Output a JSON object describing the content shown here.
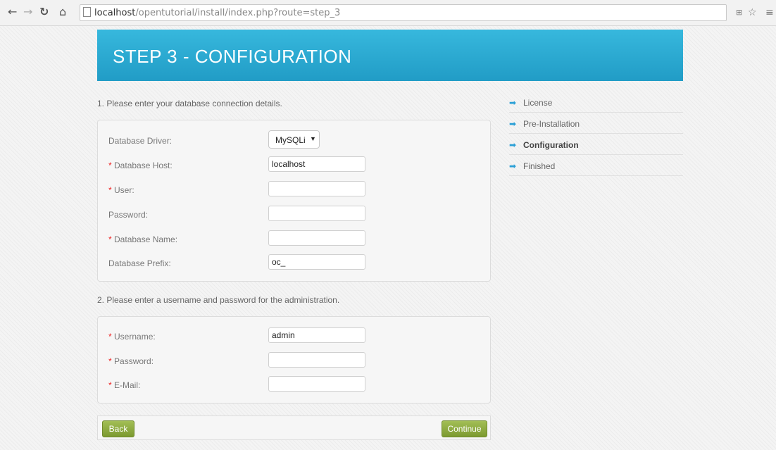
{
  "browser": {
    "url_host": "localhost",
    "url_path": "/opentutorial/install/index.php?route=step_3",
    "icons": [
      "back-arrow",
      "forward-arrow",
      "reload",
      "home",
      "page",
      "translate",
      "star",
      "menu"
    ]
  },
  "header": {
    "title": "STEP 3 - CONFIGURATION"
  },
  "section1": {
    "title": "1. Please enter your database connection details."
  },
  "db": {
    "driver_label": "Database Driver:",
    "driver_value": "MySQLi",
    "host_label": "Database Host:",
    "host_value": "localhost",
    "user_label": "User:",
    "user_value": "",
    "password_label": "Password:",
    "password_value": "",
    "name_label": "Database Name:",
    "name_value": "",
    "prefix_label": "Database Prefix:",
    "prefix_value": "oc_"
  },
  "section2": {
    "title": "2. Please enter a username and password for the administration."
  },
  "admin": {
    "username_label": "Username:",
    "username_value": "admin",
    "password_label": "Password:",
    "password_value": "",
    "email_label": "E-Mail:",
    "email_value": ""
  },
  "required_mark": "*",
  "sidebar": {
    "items": [
      {
        "label": "License"
      },
      {
        "label": "Pre-Installation"
      },
      {
        "label": "Configuration",
        "active": true
      },
      {
        "label": "Finished"
      }
    ]
  },
  "buttons": {
    "back": "Back",
    "continue": "Continue"
  },
  "colors": {
    "header": "#2aa8d3",
    "button": "#8aa83c",
    "arrow": "#2a9fd6",
    "required": "#e22222"
  }
}
